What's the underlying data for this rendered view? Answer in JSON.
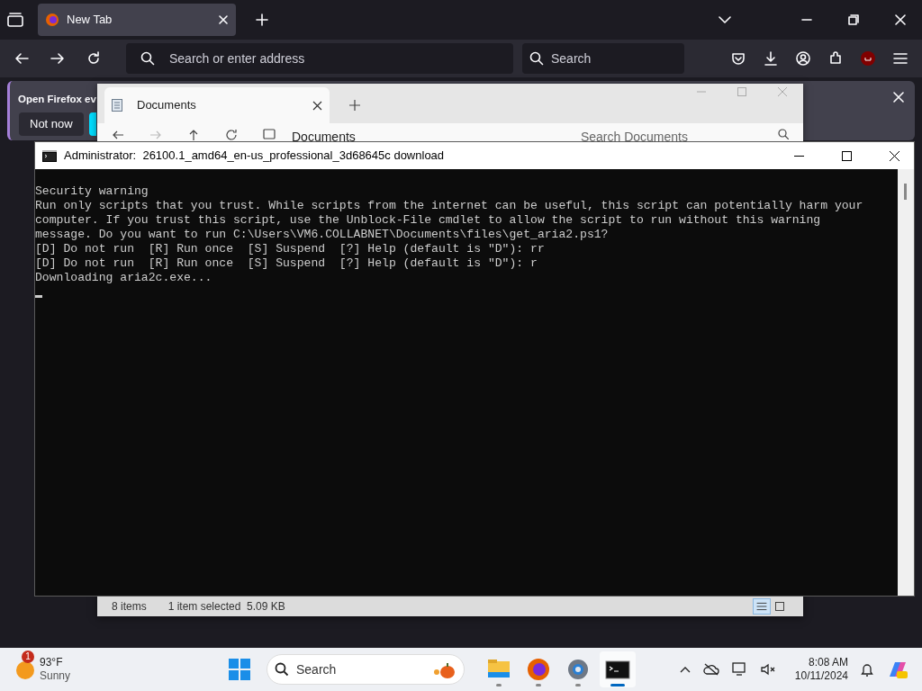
{
  "browser": {
    "tabs": [
      {
        "title": "New Tab",
        "selected": true
      }
    ],
    "address_placeholder": "Search or enter address",
    "search_placeholder": "Search",
    "notification": {
      "text": "Open Firefox ev",
      "button": "Not now"
    }
  },
  "explorer": {
    "tabs": [
      {
        "title": "Documents",
        "selected": true
      }
    ],
    "breadcrumb": "Documents",
    "search_placeholder": "Search Documents",
    "status": {
      "items": "8 items",
      "selection": "1 item selected  5.09 KB"
    },
    "views": [
      {
        "kind": "details",
        "selected": true
      },
      {
        "kind": "tiles",
        "selected": false
      }
    ]
  },
  "console": {
    "title": "Administrator:  26100.1_amd64_en-us_professional_3d68645c download",
    "lines": [
      "Security warning",
      "Run only scripts that you trust. While scripts from the internet can be useful, this script can potentially harm your",
      "computer. If you trust this script, use the Unblock-File cmdlet to allow the script to run without this warning",
      "message. Do you want to run C:\\Users\\VM6.COLLABNET\\Documents\\files\\get_aria2.ps1?",
      "[D] Do not run  [R] Run once  [S] Suspend  [?] Help (default is \"D\"): rr",
      "[D] Do not run  [R] Run once  [S] Suspend  [?] Help (default is \"D\"): r",
      "Downloading aria2c.exe..."
    ]
  },
  "taskbar": {
    "weather": {
      "badge": "1",
      "temperature": "93°F",
      "condition": "Sunny"
    },
    "search_placeholder": "Search",
    "apps": [
      {
        "kind": "files",
        "running": true,
        "active": false
      },
      {
        "kind": "firefox",
        "running": true,
        "active": false
      },
      {
        "kind": "settings",
        "running": true,
        "active": false
      },
      {
        "kind": "terminal",
        "running": true,
        "active": true
      }
    ],
    "time": "8:08 AM",
    "date": "10/11/2024"
  }
}
